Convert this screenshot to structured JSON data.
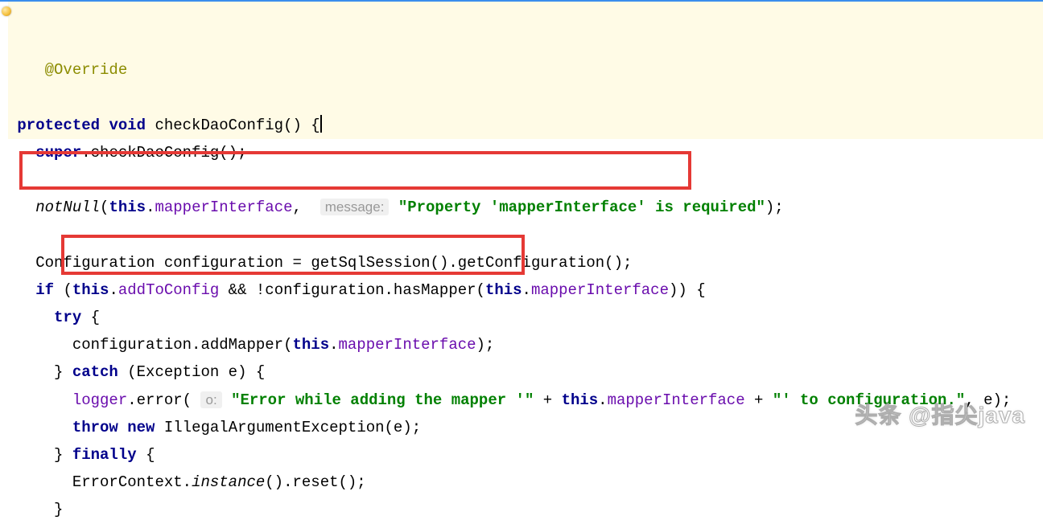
{
  "code": {
    "annotation": "@Override",
    "sig_protected": "protected",
    "sig_void": "void",
    "sig_name": "checkDaoConfig",
    "l2_super": "super",
    "l2_call": ".checkDaoConfig();",
    "l3_notnull": "notNull",
    "l3_this": "this",
    "l3_field": "mapperInterface",
    "hint_message": "message:",
    "l3_str": "\"Property 'mapperInterface' is required\"",
    "l4_type": "Configuration",
    "l4_var": "configuration",
    "l4_expr": "getSqlSession().getConfiguration();",
    "if_kw": "if",
    "l5_this": "this",
    "l5_addToConfig": "addToConfig",
    "l5_and": " && !configuration.hasMapper(",
    "l5_this2": "this",
    "l5_mapperIf": "mapperInterface",
    "try_kw": "try",
    "l7_cfg": "configuration.addMapper(",
    "l7_this": "this",
    "l7_field": "mapperInterface",
    "catch_kw": "catch",
    "catch_arg": "(Exception e) {",
    "l9_logger": "logger",
    "l9_error": ".error(",
    "hint_o": "o:",
    "l9_str1": "\"Error while adding the mapper '\"",
    "l9_plus1": " + ",
    "l9_this": "this",
    "l9_field": "mapperInterface",
    "l9_plus2": " + ",
    "l9_str2": "\"' to configuration.\"",
    "l9_end": ", e);",
    "throw_kw": "throw",
    "new_kw": "new",
    "throw_ex": "IllegalArgumentException(e);",
    "finally_kw": "finally",
    "l12_call": "ErrorContext.",
    "l12_instance": "instance",
    "l12_rest": "().reset();"
  },
  "watermark": "头条 @指尖java"
}
